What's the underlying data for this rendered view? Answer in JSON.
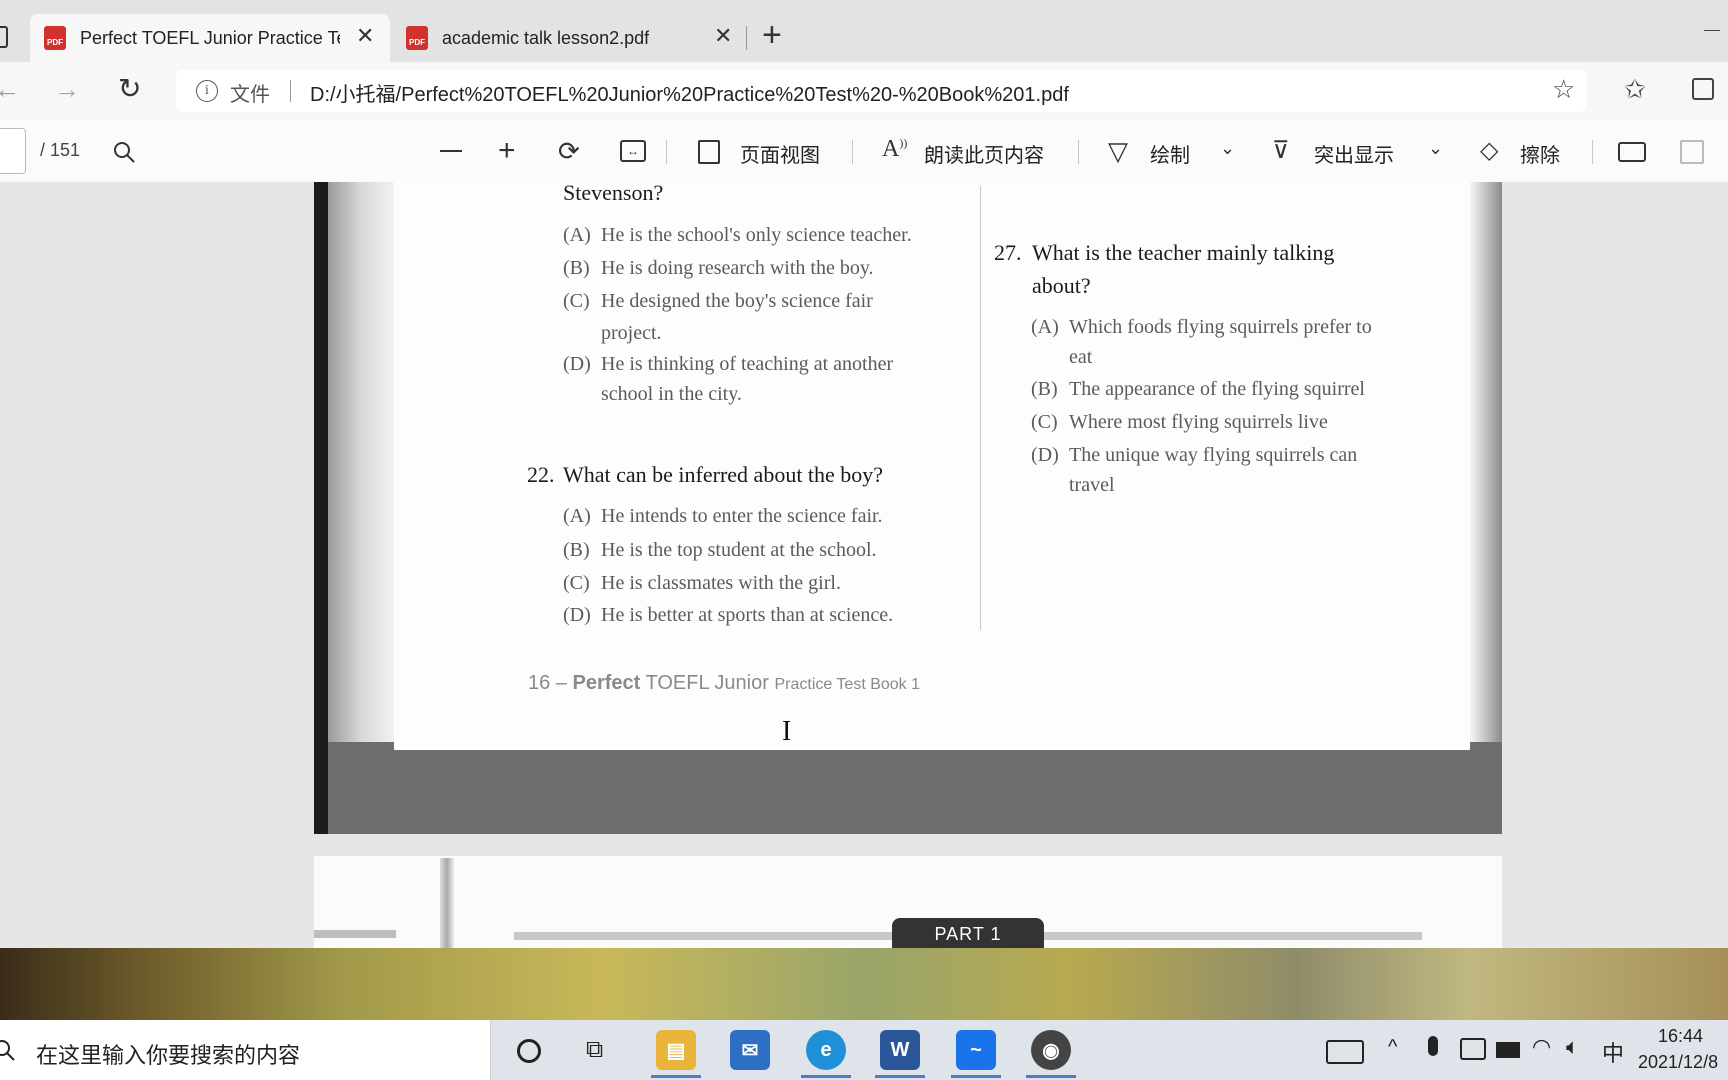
{
  "tabs": [
    {
      "title": "Perfect TOEFL Junior Practice Tes",
      "icon": "pdf-icon",
      "active": true
    },
    {
      "title": "academic talk lesson2.pdf",
      "icon": "pdf-icon",
      "active": false
    }
  ],
  "address": {
    "label": "文件",
    "url": "D:/小托福/Perfect%20TOEFL%20Junior%20Practice%20Test%20-%20Book%201.pdf"
  },
  "pdf_toolbar": {
    "page_total": "/ 151",
    "page_view": "页面视图",
    "read_aloud": "朗读此页内容",
    "draw": "绘制",
    "highlight": "突出显示",
    "erase": "擦除"
  },
  "page": {
    "q21_tail": "Stevenson?",
    "q21_options": [
      {
        "letter": "(A)",
        "text": "He is the school's only science teacher."
      },
      {
        "letter": "(B)",
        "text": "He is doing research with the boy."
      },
      {
        "letter": "(C)",
        "text": "He designed the boy's science fair"
      },
      {
        "letter": "",
        "text": "project."
      },
      {
        "letter": "(D)",
        "text": "He is thinking of teaching at another"
      },
      {
        "letter": "",
        "text": "school in the city."
      }
    ],
    "q22": {
      "number": "22.",
      "text": "What can be inferred about the boy?"
    },
    "q22_options": [
      {
        "letter": "(A)",
        "text": "He intends to enter the science fair."
      },
      {
        "letter": "(B)",
        "text": "He is the top student at the school."
      },
      {
        "letter": "(C)",
        "text": "He is classmates with the girl."
      },
      {
        "letter": "(D)",
        "text": "He is better at sports than at science."
      }
    ],
    "q27": {
      "number": "27.",
      "line1": "What is the teacher mainly talking",
      "line2": "about?"
    },
    "q27_options": [
      {
        "letter": "(A)",
        "text": "Which foods flying squirrels prefer to"
      },
      {
        "letter": "",
        "text": "eat"
      },
      {
        "letter": "(B)",
        "text": "The appearance of the flying squirrel"
      },
      {
        "letter": "(C)",
        "text": "Where most flying squirrels live"
      },
      {
        "letter": "(D)",
        "text": "The unique way flying squirrels can"
      },
      {
        "letter": "",
        "text": "travel"
      }
    ],
    "footer": {
      "num": "16 –",
      "bold": "Perfect",
      "title": "TOEFL Junior",
      "sub": "Practice Test Book 1"
    },
    "next_page_label": "PART 1"
  },
  "taskbar": {
    "search_placeholder": "在这里输入你要搜索的内容",
    "ime": "中",
    "time": "16:44",
    "date": "2021/12/8"
  }
}
